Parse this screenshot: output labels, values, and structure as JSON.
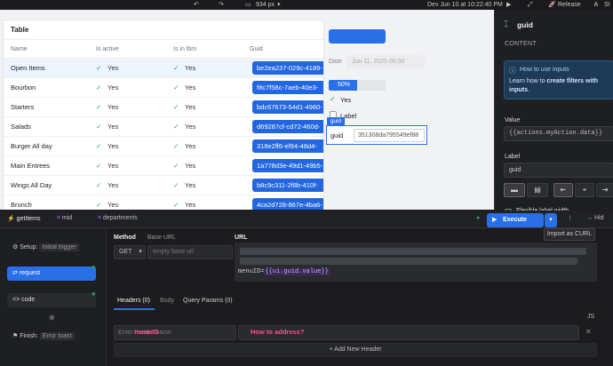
{
  "topbar": {
    "viewport": "934 px",
    "last_saved": "Dev  Jun 10 at 10:22:40 PM",
    "release_label": "Release",
    "user_initials": "SI"
  },
  "table": {
    "title": "Table",
    "columns": [
      "Name",
      "Is active",
      "Is in lbm",
      "Guid"
    ],
    "rows": [
      {
        "name": "Open Items",
        "active": "Yes",
        "lbm": "Yes",
        "guid": "be2ea237-029c-4189-"
      },
      {
        "name": "Bourbon",
        "active": "Yes",
        "lbm": "Yes",
        "guid": "f8c7f58c-7aeb-40e3-"
      },
      {
        "name": "Starters",
        "active": "Yes",
        "lbm": "Yes",
        "guid": "bdc67673-54d1-4960-"
      },
      {
        "name": "Salads",
        "active": "Yes",
        "lbm": "Yes",
        "guid": "d69287cf-cd72-460d-"
      },
      {
        "name": "Burger All day",
        "active": "Yes",
        "lbm": "Yes",
        "guid": "318e2ff6-ef94-48d4-"
      },
      {
        "name": "Main Entrees",
        "active": "Yes",
        "lbm": "Yes",
        "guid": "1a778d3e-49d1-49b5-"
      },
      {
        "name": "Wings All Day",
        "active": "Yes",
        "lbm": "Yes",
        "guid": "b8c9c311-2f8b-410f-"
      },
      {
        "name": "Brunch",
        "active": "Yes",
        "lbm": "Yes",
        "guid": "4ca2d728-867e-4ba6-"
      }
    ]
  },
  "widgets": {
    "date_label": "Date",
    "date_placeholder": "Jun 11, 2025 00:00",
    "progress_text": "50%",
    "progress_value": 0.5,
    "checkbox_value": "Yes",
    "label_text": "Label",
    "guid_tag": "guid",
    "guid_label": "guid",
    "guid_value": "351308da795549ef88"
  },
  "panel": {
    "title": "guid",
    "content_header": "CONTENT",
    "info_title": "How to use inputs",
    "info_text_pre": "Learn how to ",
    "info_text_link": "create filters with inputs",
    "info_text_post": ".",
    "value_label": "Value",
    "value_text": "{{actions.myAction.data}}",
    "label_label": "Label",
    "label_value": "guid",
    "flexible_label": "Flexible label width"
  },
  "query": {
    "tabs": [
      "getItems",
      "mid",
      "departments"
    ],
    "execute_label": "Execute action",
    "curl_label": "Import as CURL",
    "hide_label": "Hid",
    "setup_label": "Setup:",
    "setup_value": "Initial trigger",
    "request_label": "request",
    "code_label": "code",
    "finish_label": "Finish:",
    "finish_value": "Error toast",
    "method_label": "Method",
    "method_value": "GET",
    "baseurl_label": "Base URL",
    "baseurl_placeholder": "empty base url",
    "url_label": "URL",
    "url_prefix": "menuID=",
    "url_binding": "{{ui.guid.value}}",
    "header_tabs": [
      "Headers (0)",
      "Body",
      "Query Params (0)"
    ],
    "js_label": "JS",
    "header_name_placeholder": "Enter header name",
    "annot_menuid": "menuID",
    "annot_question": "How to address?",
    "add_header_label": "+  Add New Header"
  },
  "colors": {
    "accent": "#2970e8",
    "success": "#2e9e5b",
    "annotation": "#ff4d8f"
  }
}
